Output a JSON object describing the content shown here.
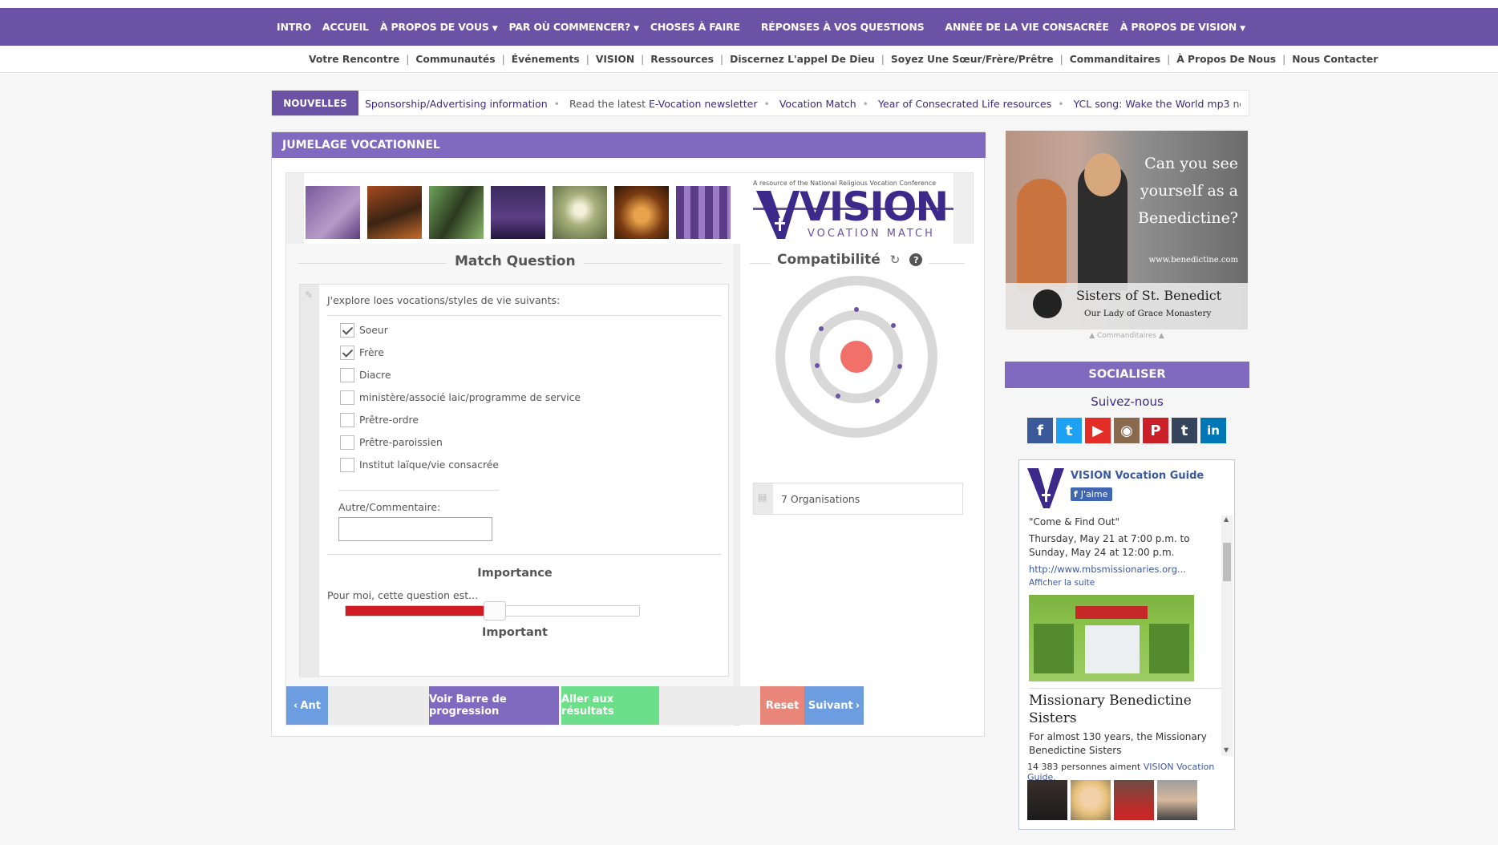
{
  "topnav": {
    "items": [
      "INTRO",
      "ACCUEIL",
      "À PROPOS DE VOUS",
      "PAR OÙ COMMENCER?",
      "CHOSES À FAIRE",
      "RÉPONSES À VOS QUESTIONS",
      "ANNÉE DE LA VIE CONSACRÉE",
      "À PROPOS DE VISION"
    ]
  },
  "subnav": {
    "items": [
      "Votre Rencontre",
      "Communautés",
      "Événements",
      "VISION",
      "Ressources",
      "Discernez L'appel De Dieu",
      "Soyez Une Sœur/Frère/Prêtre",
      "Commanditaires",
      "À Propos De Nous",
      "Nous Contacter"
    ]
  },
  "ticker": {
    "label": "NOUVELLES",
    "items": [
      "Sponsorship/Advertising information",
      "Read the latest",
      "E-Vocation newsletter",
      "Vocation Match",
      "Year of Consecrated Life resources",
      "YCL song: Wake the World mp3",
      "now availab"
    ]
  },
  "main": {
    "header": "JUMELAGE VOCATIONNEL",
    "match_title": "Match Question",
    "question": "J'explore loes vocations/styles de vie suivants:",
    "options": [
      {
        "label": "Soeur",
        "checked": true
      },
      {
        "label": "Frère",
        "checked": true
      },
      {
        "label": "Diacre",
        "checked": false
      },
      {
        "label": "ministère/associé laic/programme de service",
        "checked": false
      },
      {
        "label": "Prêtre-ordre",
        "checked": false
      },
      {
        "label": "Prêtre-paroissien",
        "checked": false
      },
      {
        "label": "Institut laïque/vie consacrée",
        "checked": false
      }
    ],
    "other_label": "Autre/Commentaire:",
    "importance_title": "Importance",
    "importance_prompt": "Pour moi, cette question est...",
    "importance_value_label": "Important",
    "importance_level": 0.48,
    "compat_title": "Compatibilité",
    "orgs_text": "7 Organisations",
    "buttons": {
      "prev": "Ant",
      "progress": "Voir Barre de progression",
      "results": "Aller aux résultats",
      "reset": "Reset",
      "next": "Suivant"
    },
    "banner": {
      "tagline": "A resource of the National Religious Vocation Conference",
      "brand": "VISION",
      "sub": "VOCATION MATCH"
    }
  },
  "sidebar": {
    "ad": {
      "headline": "Can you see yourself as a Benedictine?",
      "url": "www.benedictine.com",
      "org": "Sisters of St. Benedict",
      "org_sub": "Our Lady of Grace Monastery"
    },
    "ad_note": "▲ Commanditaires ▲",
    "social_title": "SOCIALISER",
    "follow": "Suivez-nous",
    "facebook": {
      "page_name": "VISION Vocation Guide",
      "like": "J'aime",
      "post_lines": [
        "\"Come & Find Out\"",
        "Thursday, May 21 at 7:00 p.m. to Sunday, May 24 at 12:00 p.m."
      ],
      "post_link": "http://www.mbsmissionaries.org...",
      "more": "Afficher la suite",
      "card_title": "Missionary Benedictine Sisters",
      "card_text": "For almost 130 years, the Missionary Benedictine Sisters",
      "count": "14 383 personnes aiment",
      "count_link": "VISION Vocation Guide."
    }
  },
  "colors": {
    "purple": "#6b52a5",
    "header_purple": "#7f6ac0",
    "red": "#d11b23",
    "green": "#6dde8a",
    "blue": "#6c9de0",
    "salmon": "#e9867a"
  }
}
